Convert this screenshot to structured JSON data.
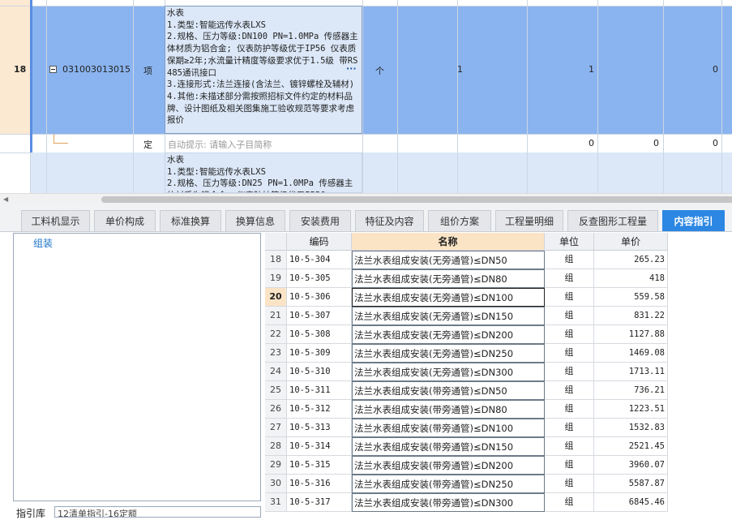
{
  "grid": {
    "row18": {
      "number": "18",
      "code": "031003013015",
      "type": "项",
      "description": "水表\n1.类型:智能远传水表LXS\n2.规格、压力等级:DN100 PN=1.0MPa 传感器主体材质为铝合金; 仪表防护等级优于IP56 仪表质保期≥2年;水流量计精度等级要求优于1.5级 带RS485通讯接口\n3.连接形式:法兰连接(含法兰、镀锌螺栓及辅材)\n4.其他:未描述部分需按照招标文件约定的材料品牌、设计图纸及相关图集施工验收规范等要求考虑报价",
      "more": "···",
      "unit": "个",
      "qty1": "1",
      "qty2": "1",
      "qty3": "0"
    },
    "sub_row": {
      "type": "定",
      "hint": "自动提示: 请输入子目简称",
      "v1": "0",
      "v2": "0",
      "v3": "0"
    },
    "row19_partial": {
      "description": "水表\n1.类型:智能远传水表LXS\n2.规格、压力等级:DN25 PN=1.0MPa 传感器主体材质为铝合金; 仪表防护等级优于IP56"
    }
  },
  "tabs": [
    {
      "label": "工料机显示"
    },
    {
      "label": "单价构成"
    },
    {
      "label": "标准换算"
    },
    {
      "label": "换算信息"
    },
    {
      "label": "安装费用"
    },
    {
      "label": "特征及内容"
    },
    {
      "label": "组价方案"
    },
    {
      "label": "工程量明细"
    },
    {
      "label": "反查图形工程量"
    },
    {
      "label": "内容指引",
      "active": true
    }
  ],
  "tree": {
    "item": "组装"
  },
  "guide": {
    "label": "指引库",
    "value": "12清单指引-16定额"
  },
  "table": {
    "columns": [
      "编码",
      "名称",
      "单位",
      "单价"
    ],
    "current_row": "20",
    "rows": [
      {
        "num": "18",
        "code": "10-5-304",
        "name": "法兰水表组成安装(无旁通管)≤DN50",
        "unit": "组",
        "price": "265.23"
      },
      {
        "num": "19",
        "code": "10-5-305",
        "name": "法兰水表组成安装(无旁通管)≤DN80",
        "unit": "组",
        "price": "418"
      },
      {
        "num": "20",
        "code": "10-5-306",
        "name": "法兰水表组成安装(无旁通管)≤DN100",
        "unit": "组",
        "price": "559.58"
      },
      {
        "num": "21",
        "code": "10-5-307",
        "name": "法兰水表组成安装(无旁通管)≤DN150",
        "unit": "组",
        "price": "831.22"
      },
      {
        "num": "22",
        "code": "10-5-308",
        "name": "法兰水表组成安装(无旁通管)≤DN200",
        "unit": "组",
        "price": "1127.88"
      },
      {
        "num": "23",
        "code": "10-5-309",
        "name": "法兰水表组成安装(无旁通管)≤DN250",
        "unit": "组",
        "price": "1469.08"
      },
      {
        "num": "24",
        "code": "10-5-310",
        "name": "法兰水表组成安装(无旁通管)≤DN300",
        "unit": "组",
        "price": "1713.11"
      },
      {
        "num": "25",
        "code": "10-5-311",
        "name": "法兰水表组成安装(带旁通管)≤DN50",
        "unit": "组",
        "price": "736.21"
      },
      {
        "num": "26",
        "code": "10-5-312",
        "name": "法兰水表组成安装(带旁通管)≤DN80",
        "unit": "组",
        "price": "1223.51"
      },
      {
        "num": "27",
        "code": "10-5-313",
        "name": "法兰水表组成安装(带旁通管)≤DN100",
        "unit": "组",
        "price": "1532.83"
      },
      {
        "num": "28",
        "code": "10-5-314",
        "name": "法兰水表组成安装(带旁通管)≤DN150",
        "unit": "组",
        "price": "2521.45"
      },
      {
        "num": "29",
        "code": "10-5-315",
        "name": "法兰水表组成安装(带旁通管)≤DN200",
        "unit": "组",
        "price": "3960.07"
      },
      {
        "num": "30",
        "code": "10-5-316",
        "name": "法兰水表组成安装(带旁通管)≤DN250",
        "unit": "组",
        "price": "5587.87"
      },
      {
        "num": "31",
        "code": "10-5-317",
        "name": "法兰水表组成安装(带旁通管)≤DN300",
        "unit": "组",
        "price": "6845.46"
      }
    ]
  }
}
